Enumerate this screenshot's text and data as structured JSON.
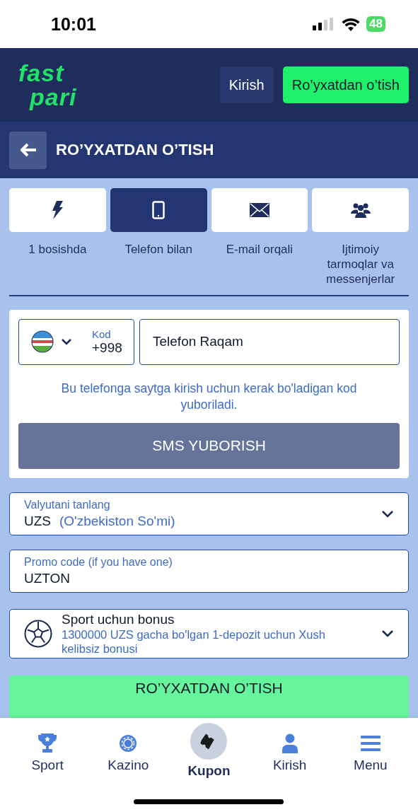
{
  "status_bar": {
    "time": "10:01",
    "battery": "48"
  },
  "header": {
    "logo": [
      "fast",
      "pari"
    ],
    "login_button": "Kirish",
    "register_button": "Ro’yxatdan o’tish"
  },
  "page_title": "RO’YXATDAN O’TISH",
  "methods": [
    {
      "label": "1 bosishda",
      "selected": false
    },
    {
      "label": "Telefon bilan",
      "selected": true
    },
    {
      "label": "E-mail orqali",
      "selected": false
    },
    {
      "label": "Ijtimoiy tarmoqlar va messenjerlar",
      "selected": false
    }
  ],
  "phone_form": {
    "code_label": "Kod",
    "code": "+998",
    "phone_placeholder": "Telefon Raqam",
    "hint": "Bu telefonga saytga kirish uchun kerak bo'ladigan kod yuboriladi.",
    "sms_button": {
      "label": "SMS YUBORISH",
      "disabled": true
    }
  },
  "currency": {
    "label": "Valyutani tanlang",
    "code": "UZS",
    "name": "(O'zbekiston So'mi)"
  },
  "promo": {
    "label": "Promo code (if you have one)",
    "value": "UZTON"
  },
  "bonus": {
    "title": "Sport uchun bonus",
    "description": "1300000 UZS gacha bo'lgan 1-depozit uchun Xush kelibsiz bonusi"
  },
  "submit_button": "RO’YXATDAN O’TISH",
  "bottom_nav": [
    {
      "label": "Sport",
      "selected": false
    },
    {
      "label": "Kazino",
      "selected": false
    },
    {
      "label": "Kupon",
      "selected": true
    },
    {
      "label": "Kirish",
      "selected": false
    },
    {
      "label": "Menu",
      "selected": false
    }
  ]
}
